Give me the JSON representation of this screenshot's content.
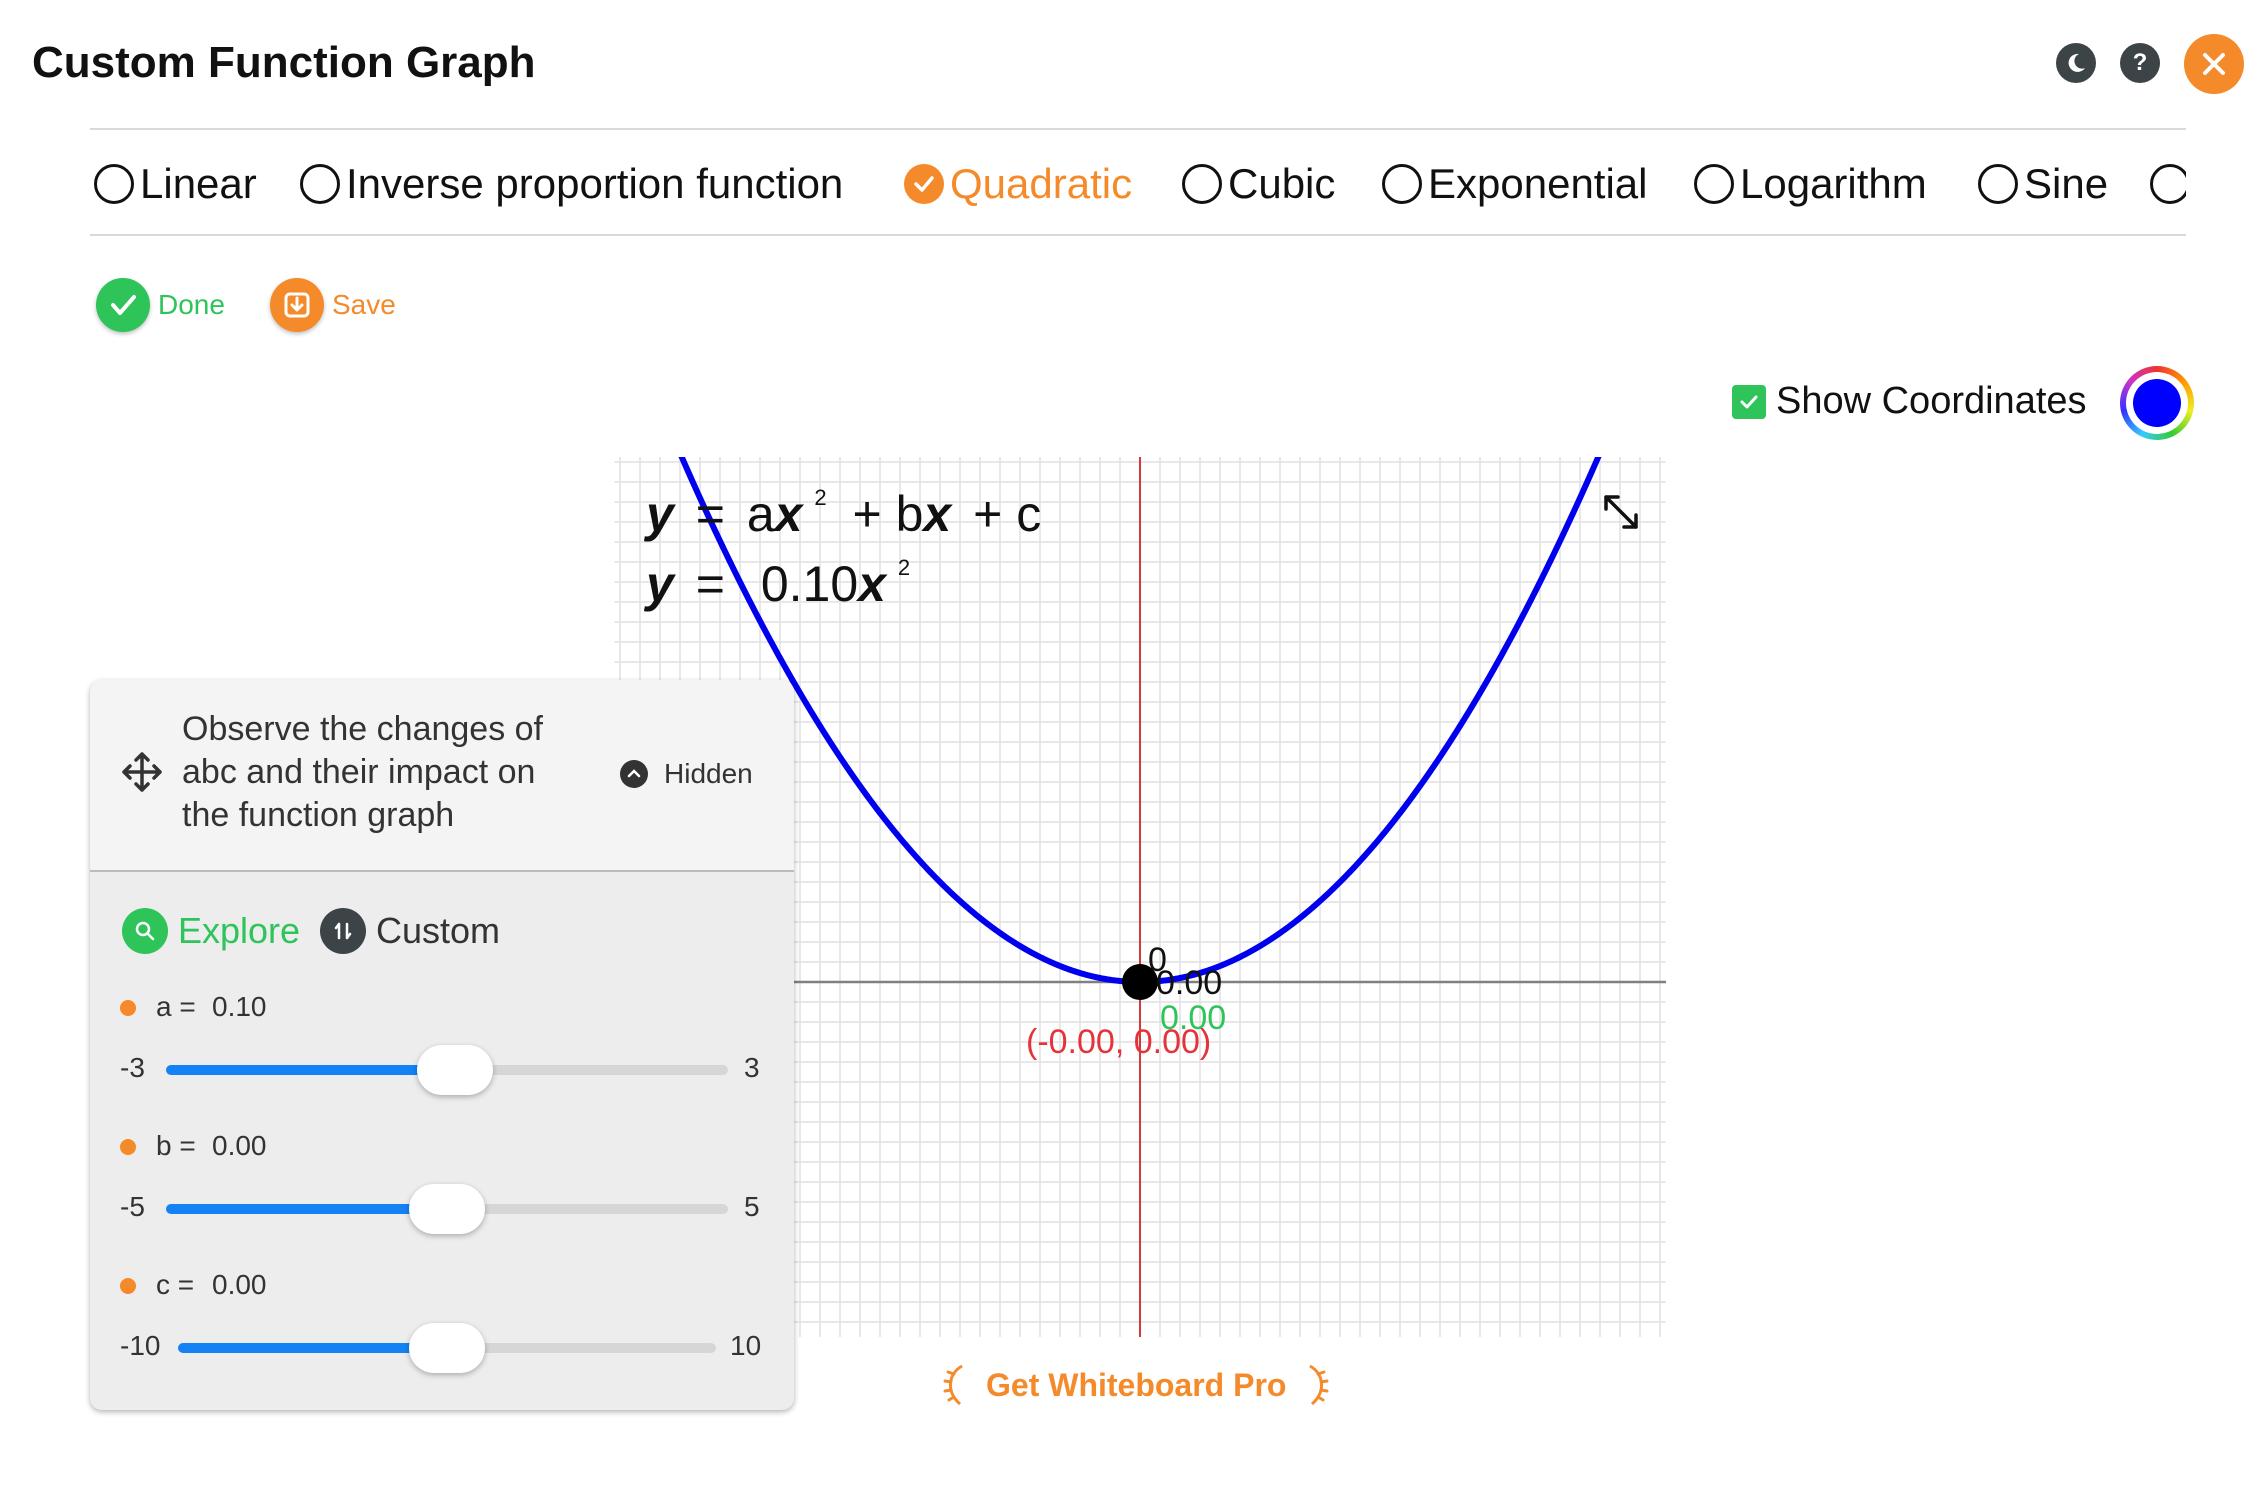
{
  "header": {
    "title": "Custom Function Graph"
  },
  "top_icons": [
    "moon-icon",
    "help-icon",
    "close-icon"
  ],
  "tabs": [
    {
      "label": "Linear",
      "checked": false
    },
    {
      "label": "Inverse proportion function",
      "checked": false
    },
    {
      "label": "Quadratic",
      "checked": true
    },
    {
      "label": "Cubic",
      "checked": false
    },
    {
      "label": "Exponential",
      "checked": false
    },
    {
      "label": "Logarithm",
      "checked": false
    },
    {
      "label": "Sine",
      "checked": false
    }
  ],
  "actions": {
    "done": "Done",
    "save": "Save"
  },
  "show_coordinates": {
    "label": "Show Coordinates",
    "checked": true,
    "color": "#0000ff"
  },
  "graph": {
    "formula_general": {
      "y": "y",
      "eq": "=",
      "a": "a",
      "x": "x",
      "exp": "2",
      "rest1": "+ b",
      "x2": "x",
      "rest2": "+ c"
    },
    "formula_specific": {
      "y": "y",
      "eq": "=",
      "coef": "0.10",
      "x": "x",
      "exp": "2"
    },
    "origin_label": "0",
    "vertex_y_label": "0.00",
    "vertex_x_label": "0.00",
    "vertex_point_label": "(-0.00, 0.00)",
    "curve_color": "#0000ee",
    "axis_color": "#d23b3b",
    "point_label_color": "#e5333b",
    "x_label_color": "#2ec45a",
    "a": 0.1,
    "b": 0.0,
    "c": 0.0,
    "expand_icon": "expand-icon"
  },
  "panel": {
    "description": "Observe the changes of abc and their impact on the function graph",
    "desc_line1": "Observe the changes of",
    "desc_line2": "abc and their impact on",
    "desc_line3": "the function graph",
    "hidden_label": "Hidden",
    "mode_explore": "Explore",
    "mode_custom": "Custom",
    "params": [
      {
        "name": "a =",
        "value": "0.10",
        "min": "-3",
        "max": "3",
        "fraction": 0.517
      },
      {
        "name": "b =",
        "value": "0.00",
        "min": "-5",
        "max": "5",
        "fraction": 0.5
      },
      {
        "name": "c =",
        "value": "0.00",
        "min": "-10",
        "max": "10",
        "fraction": 0.5
      }
    ]
  },
  "promo": {
    "label": "Get Whiteboard Pro"
  }
}
